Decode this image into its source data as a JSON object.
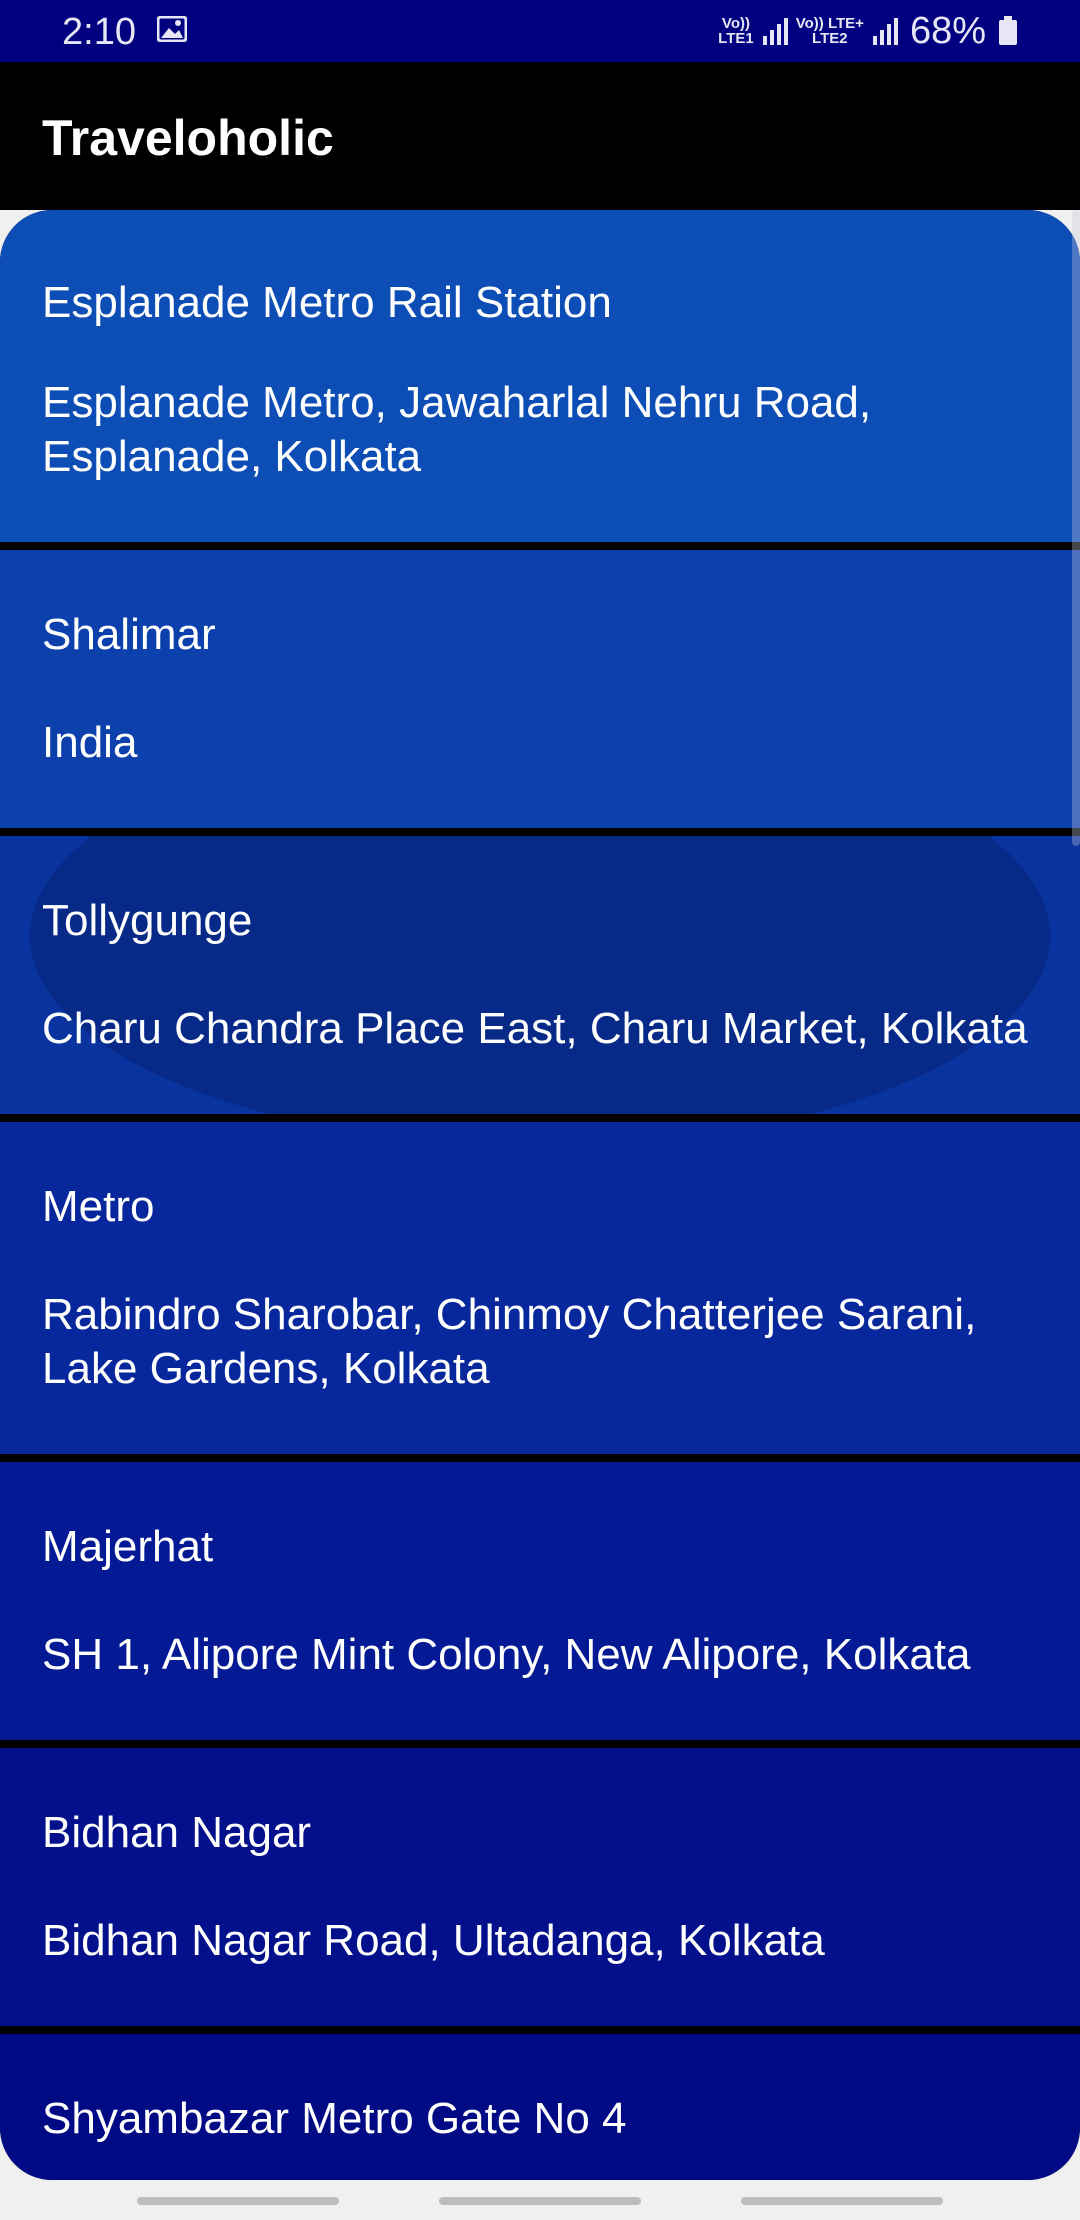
{
  "status_bar": {
    "time": "2:10",
    "gallery_icon": "image-icon",
    "sim1_label_top": "Vo))",
    "sim1_label_bottom": "LTE1",
    "sim2_label_top": "Vo)) LTE+",
    "sim2_label_bottom": "LTE2",
    "battery": "68%"
  },
  "app_bar": {
    "title": "Traveloholic"
  },
  "places": [
    {
      "name": "Esplanade Metro Rail Station",
      "address": "Esplanade Metro, Jawaharlal Nehru Road, Esplanade, Kolkata",
      "color": "#0d4eb6"
    },
    {
      "name": "Shalimar",
      "address": "India",
      "color": "#0b40ad"
    },
    {
      "name": "Tollygunge",
      "address": "Charu Chandra Place East, Charu Market, Kolkata",
      "color": "#09349f"
    },
    {
      "name": "Metro",
      "address": "Rabindro Sharobar, Chinmoy Chatterjee Sarani, Lake Gardens, Kolkata",
      "color": "#07279c"
    },
    {
      "name": "Majerhat",
      "address": "SH 1, Alipore Mint Colony, New Alipore, Kolkata",
      "color": "#041a94"
    },
    {
      "name": "Bidhan Nagar",
      "address": "Bidhan Nagar Road, Ultadanga, Kolkata",
      "color": "#02108b"
    },
    {
      "name": "Shyambazar Metro Gate No 4",
      "address": "",
      "color": "#000a85"
    }
  ]
}
